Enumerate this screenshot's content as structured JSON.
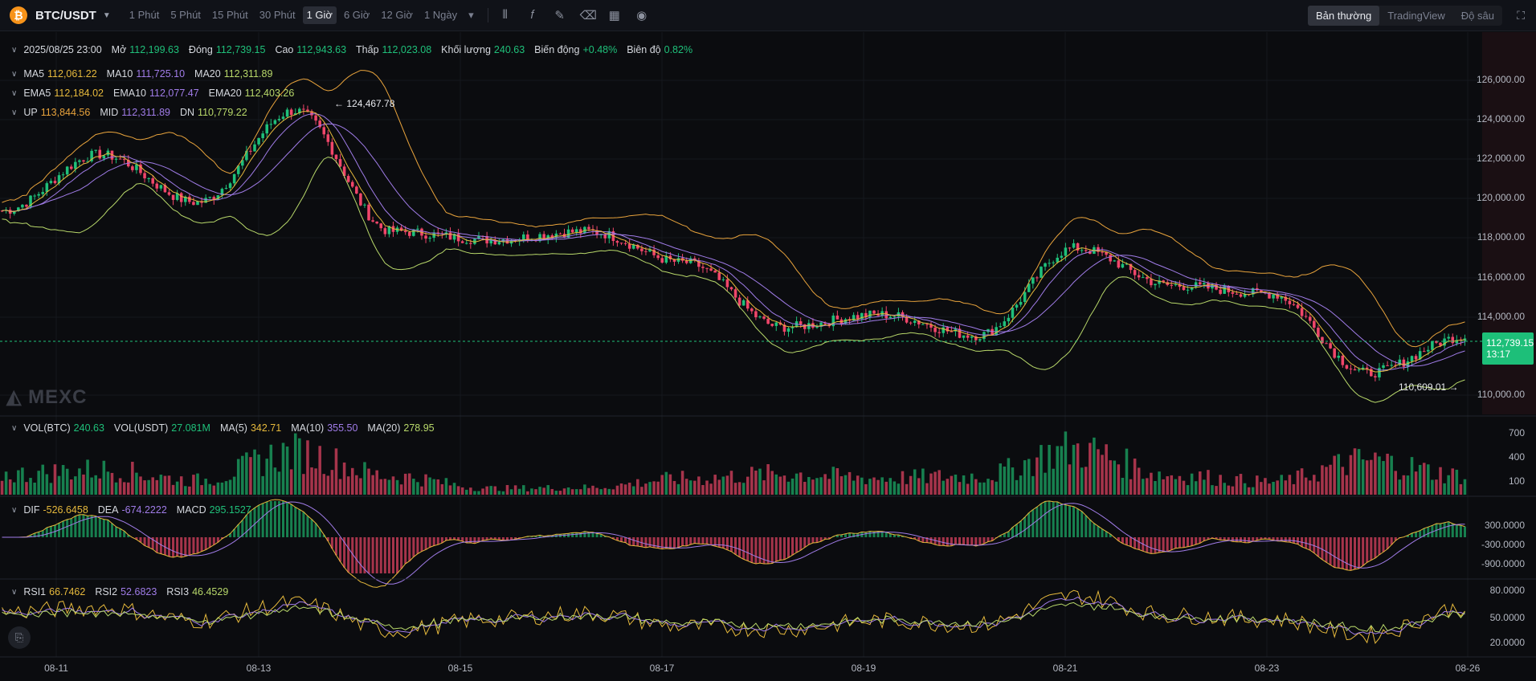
{
  "toolbar": {
    "pair": "BTC/USDT",
    "coin_symbol": "₿",
    "intervals": [
      "1 Phút",
      "5 Phút",
      "15 Phút",
      "30 Phút",
      "1 Giờ",
      "6 Giờ",
      "12 Giờ",
      "1 Ngày"
    ],
    "active_interval": "1 Giờ",
    "views": [
      "Bản thường",
      "TradingView",
      "Độ sâu"
    ],
    "active_view": "Bản thường"
  },
  "ohlc": {
    "date": "2025/08/25 23:00",
    "open_label": "Mở",
    "open": "112,199.63",
    "close_label": "Đóng",
    "close": "112,739.15",
    "high_label": "Cao",
    "high": "112,943.63",
    "low_label": "Thấp",
    "low": "112,023.08",
    "volume_label": "Khối lượng",
    "volume": "240.63",
    "change_label": "Biến động",
    "change": "+0.48%",
    "amplitude_label": "Biên độ",
    "amplitude": "0.82%"
  },
  "ma": {
    "ma5_label": "MA5",
    "ma5": "112,061.22",
    "ma10_label": "MA10",
    "ma10": "111,725.10",
    "ma20_label": "MA20",
    "ma20": "112,311.89"
  },
  "ema": {
    "ema5_label": "EMA5",
    "ema5": "112,184.02",
    "ema10_label": "EMA10",
    "ema10": "112,077.47",
    "ema20_label": "EMA20",
    "ema20": "112,403.26"
  },
  "boll": {
    "up_label": "UP",
    "up": "113,844.56",
    "mid_label": "MID",
    "mid": "112,311.89",
    "dn_label": "DN",
    "dn": "110,779.22"
  },
  "vol": {
    "btc_label": "VOL(BTC)",
    "btc": "240.63",
    "usdt_label": "VOL(USDT)",
    "usdt": "27.081M",
    "ma5_label": "MA(5)",
    "ma5": "342.71",
    "ma10_label": "MA(10)",
    "ma10": "355.50",
    "ma20_label": "MA(20)",
    "ma20": "278.95"
  },
  "macd": {
    "dif_label": "DIF",
    "dif": "-526.6458",
    "dea_label": "DEA",
    "dea": "-674.2222",
    "macd_label": "MACD",
    "macd": "295.1527"
  },
  "rsi": {
    "rsi1_label": "RSI1",
    "rsi1": "66.7462",
    "rsi2_label": "RSI2",
    "rsi2": "52.6823",
    "rsi3_label": "RSI3",
    "rsi3": "46.4529"
  },
  "price_axis": [
    "126,000.00",
    "124,000.00",
    "122,000.00",
    "120,000.00",
    "118,000.00",
    "116,000.00",
    "114,000.00",
    "110,000.00"
  ],
  "vol_axis": [
    "700",
    "400",
    "100"
  ],
  "macd_axis": [
    "300.0000",
    "-300.0000",
    "-900.0000"
  ],
  "rsi_axis": [
    "80.0000",
    "50.0000",
    "20.0000"
  ],
  "dates": [
    "08-11",
    "08-13",
    "08-15",
    "08-17",
    "08-19",
    "08-21",
    "08-23",
    "08-26"
  ],
  "current_price": {
    "price": "112,739.15",
    "countdown": "13:17"
  },
  "annotations": {
    "high": "124,467.78",
    "low": "110,609.01"
  },
  "watermark": "MEXC",
  "colors": {
    "up": "#1fc07a",
    "down": "#f0466a",
    "ma5": "#e6b93c",
    "ma10": "#a07ce8",
    "ma20": "#b8d86a",
    "boll": "#e8a33c"
  },
  "chart_data": {
    "type": "candlestick",
    "x": [
      "08-11",
      "08-12",
      "08-13",
      "08-14",
      "08-15",
      "08-16",
      "08-17",
      "08-18",
      "08-19",
      "08-20",
      "08-21",
      "08-22",
      "08-23",
      "08-24",
      "08-25",
      "08-26"
    ],
    "series": [
      {
        "name": "price",
        "values": [
          118800,
          121500,
          119200,
          123600,
          117800,
          117400,
          117800,
          116300,
          113200,
          113800,
          112800,
          117000,
          115200,
          114800,
          111000,
          112739
        ]
      },
      {
        "name": "VOL(BTC)",
        "values": [
          250,
          310,
          180,
          520,
          230,
          80,
          90,
          200,
          260,
          210,
          230,
          560,
          240,
          160,
          420,
          240
        ]
      },
      {
        "name": "RSI1",
        "values": [
          60,
          66,
          48,
          72,
          34,
          50,
          58,
          40,
          36,
          48,
          42,
          82,
          55,
          50,
          28,
          66
        ]
      }
    ],
    "ylim": [
      109000,
      127000
    ],
    "high_mark": {
      "x": "08-14",
      "y": 124467.78
    },
    "low_mark": {
      "x": "08-25",
      "y": 110609.01
    },
    "grid": true
  }
}
